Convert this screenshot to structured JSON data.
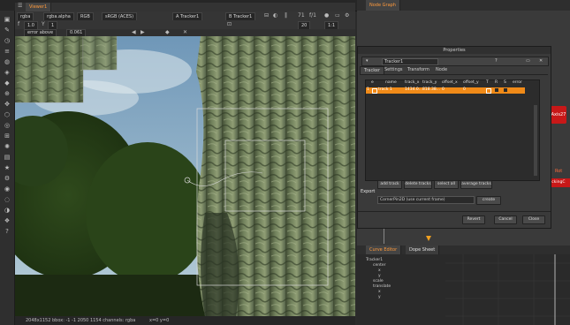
{
  "viewer": {
    "tab": "Viewer1",
    "channels": "rgba",
    "layer": "rgba.alpha",
    "colorspace": "RGB",
    "view_transform": "sRGB (ACES)",
    "input_a": "A  Tracker1",
    "input_b": "B  Tracker1",
    "frame": "71",
    "fps_label": "f/1",
    "frame_end": "20",
    "zoom": "1:1",
    "error_mode": "error above",
    "error_value": "0.061",
    "status": "2048x1152  bbox: -1 -1 2050 1154 channels: rgba",
    "coords": "x=0 y=0",
    "colors": {
      "accent": "#ff9a3c",
      "tracker_box": "#d8d8d8"
    }
  },
  "node_graph": {
    "tab": "Node Graph",
    "nodes": [
      {
        "label": "Axis27"
      },
      {
        "label": "Rot"
      },
      {
        "label": "...ckingC"
      }
    ]
  },
  "properties": {
    "title": "Properties",
    "node_name": "Tracker1",
    "tabs": [
      "Tracker",
      "Settings",
      "Transform",
      "Node"
    ],
    "columns": [
      "e",
      "name",
      "track_x",
      "track_y",
      "offset_x",
      "offset_y",
      "T",
      "R",
      "S",
      "error"
    ],
    "rows": [
      {
        "index": "1",
        "name": "track 1",
        "track_x": "1434.0...",
        "track_y": "818.38...",
        "offset_x": "0",
        "offset_y": "0"
      }
    ],
    "buttons": [
      "add track",
      "delete tracks",
      "select all",
      "average tracks"
    ],
    "export_label": "Export",
    "export_option": "CornerPin2D (use current frame)",
    "create_label": "create",
    "footer_buttons": [
      "Revert",
      "Cancel",
      "Close"
    ]
  },
  "curve_editor": {
    "tabs": [
      "Curve Editor",
      "Dope Sheet"
    ],
    "tree": [
      "Tracker1",
      "center",
      "x",
      "y",
      "scale",
      "translate",
      "x",
      "y"
    ]
  }
}
